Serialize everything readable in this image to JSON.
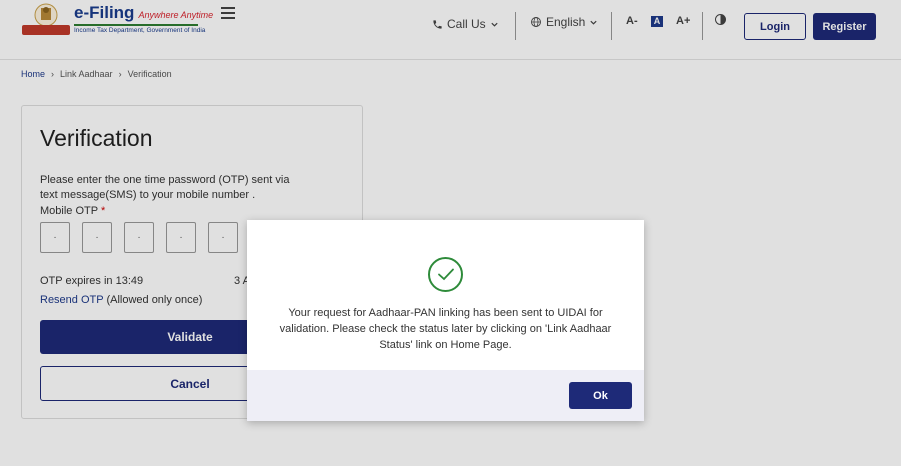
{
  "header": {
    "brand_name": "e-Filing",
    "brand_tagline": "Anywhere Anytime",
    "brand_subtitle": "Income Tax Department, Government of India",
    "call_us": "Call Us",
    "language": "English",
    "font_decrease": "A-",
    "font_default": "A",
    "font_increase": "A+",
    "login_label": "Login",
    "register_label": "Register"
  },
  "breadcrumb": {
    "home": "Home",
    "link_aadhaar": "Link Aadhaar",
    "current": "Verification"
  },
  "verification": {
    "title": "Verification",
    "description": "Please enter the one time password (OTP) sent via text message(SMS) to your mobile number .",
    "otp_label": "Mobile OTP",
    "otp_required_mark": "*",
    "otp_placeholder": "·",
    "expires_text": "OTP expires in 13:49",
    "attempts_text": "3 A",
    "resend_link": "Resend OTP",
    "resend_note": "(Allowed only once)",
    "validate_label": "Validate",
    "cancel_label": "Cancel"
  },
  "modal": {
    "icon": "check-circle-icon",
    "message": "Your request for Aadhaar-PAN linking has been sent to UIDAI for validation. Please check the status later by clicking on 'Link Aadhaar Status' link on Home Page.",
    "ok_label": "Ok"
  },
  "colors": {
    "primary": "#1e2a78",
    "success": "#2e8b3a",
    "link": "#1e3a8a"
  }
}
